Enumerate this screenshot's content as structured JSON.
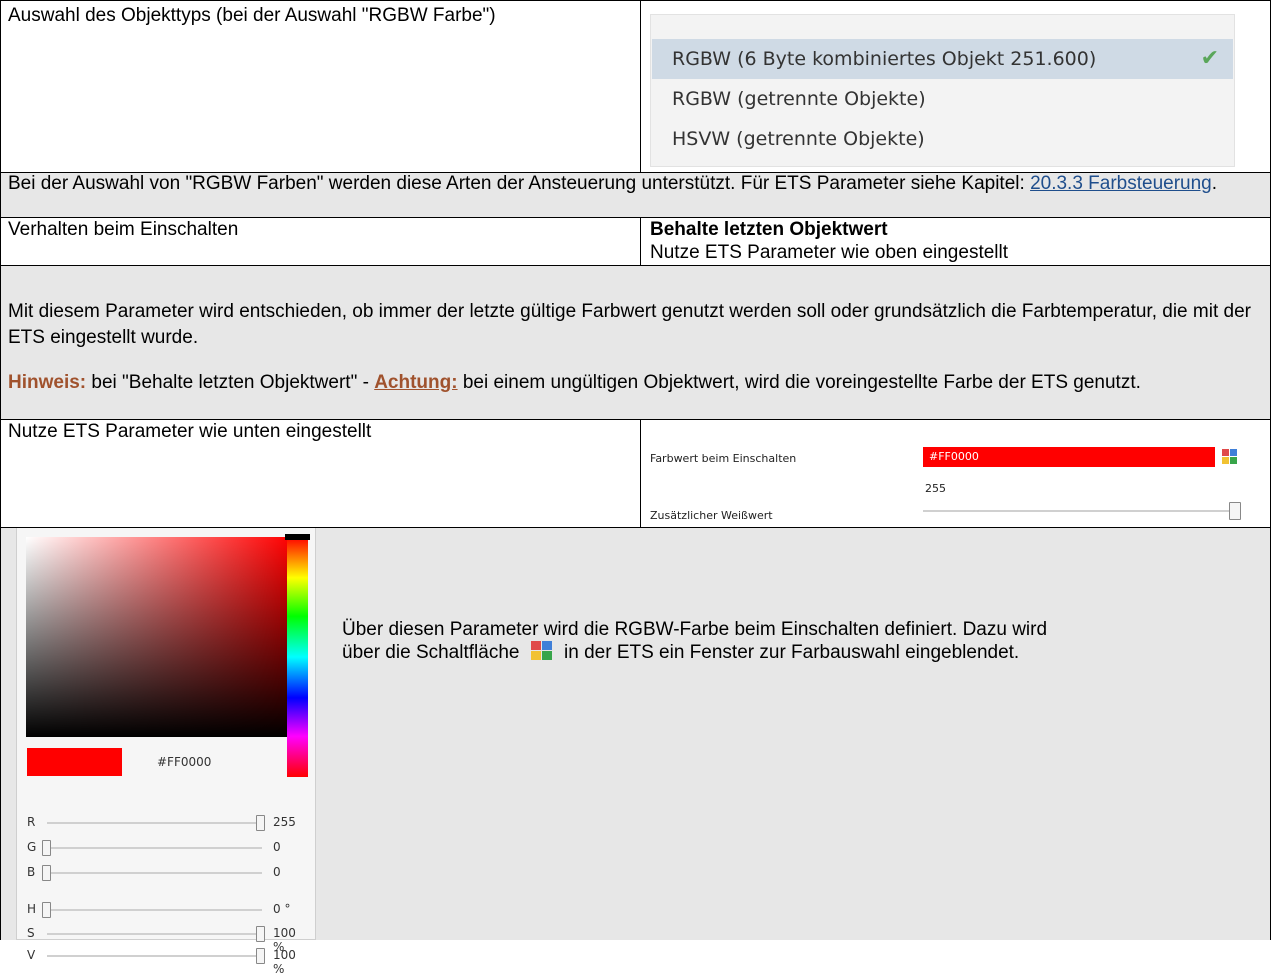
{
  "row1": {
    "label": "Auswahl des Objekttyps (bei der Auswahl \"RGBW Farbe\")",
    "options": [
      {
        "label": "RGBW (6 Byte kombiniertes Objekt 251.600)",
        "selected": true
      },
      {
        "label": "RGBW (getrennte Objekte)",
        "selected": false
      },
      {
        "label": "HSVW (getrennte Objekte)",
        "selected": false
      }
    ]
  },
  "row2": {
    "text_before": "Bei der Auswahl von \"RGBW Farben\" werden diese Arten der Ansteuerung unterstützt. Für ETS Parameter siehe Kapitel: ",
    "link": "20.3.3 Farbsteuerung",
    "text_after": "."
  },
  "row3": {
    "label": "Verhalten beim Einschalten",
    "option_bold": "Behalte letzten Objektwert",
    "option_2": "Nutze ETS Parameter wie oben eingestellt"
  },
  "row4": {
    "para": "Mit diesem Parameter wird entschieden, ob immer der letzte gültige Farbwert genutzt werden soll oder grundsätzlich die Farbtemperatur, die mit der ETS eingestellt wurde.",
    "hint_label": "Hinweis:",
    "hint_text": " bei \"Behalte letzten Objektwert\" - ",
    "attention_label": "Achtung:",
    "attention_text": " bei einem ungültigen Objektwert, wird die voreingestellte Farbe der ETS genutzt."
  },
  "row5": {
    "label": "Nutze ETS Parameter wie unten eingestellt",
    "param1_label": "Farbwert beim Einschalten",
    "param1_value": "#FF0000",
    "param2_label": "Zusätzlicher Weißwert",
    "param2_value": "255",
    "param2_level": 1.0
  },
  "row6": {
    "desc_1": "Über diesen Parameter wird die RGBW-Farbe beim Einschalten definiert. Dazu wird",
    "desc_2a": "über die Schaltfläche",
    "desc_2b": "in der ETS ein Fenster zur Farbauswahl eingeblendet.",
    "picker": {
      "hex": "#FF0000",
      "sliders": [
        {
          "label": "R",
          "value": "255",
          "level": 1.0
        },
        {
          "label": "G",
          "value": "0",
          "level": 0.0
        },
        {
          "label": "B",
          "value": "0",
          "level": 0.0
        },
        {
          "label": "H",
          "value": "0 °",
          "level": 0.0
        },
        {
          "label": "S",
          "value": "100 %",
          "level": 1.0
        },
        {
          "label": "V",
          "value": "100 %",
          "level": 1.0
        }
      ]
    }
  },
  "colors": {
    "red": "#ff0000",
    "link": "#1f4e8c",
    "accent_orange": "#a0522d",
    "row_gray": "#e7e7e7"
  }
}
